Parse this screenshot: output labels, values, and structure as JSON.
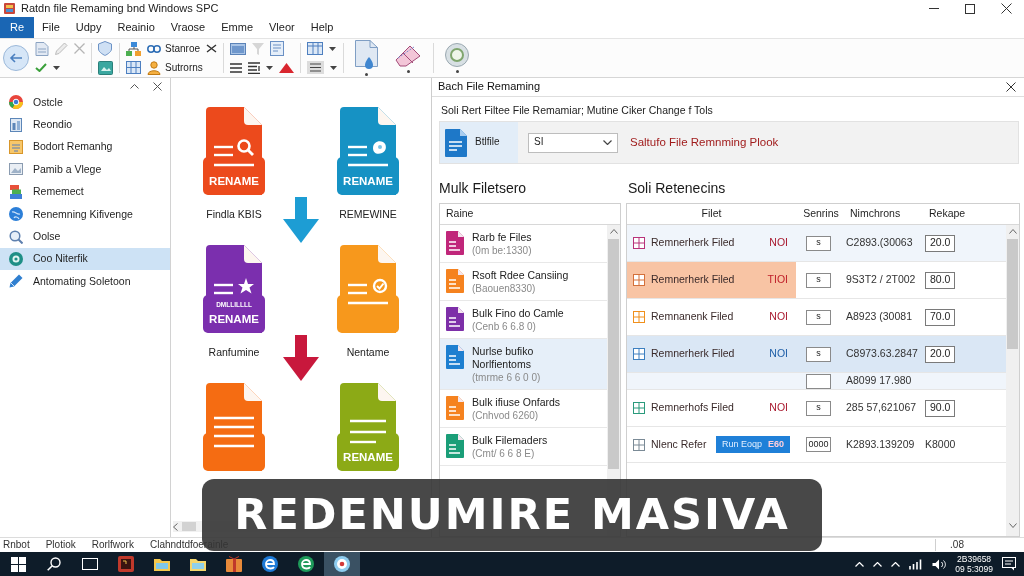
{
  "window": {
    "title": "Ratdn file Remaming bnd Windows SPC"
  },
  "menu": [
    {
      "label": "Re",
      "selected": true
    },
    {
      "label": "File",
      "selected": false
    },
    {
      "label": "Udpy",
      "selected": false
    },
    {
      "label": "Reainio",
      "selected": false
    },
    {
      "label": "Vraose",
      "selected": false
    },
    {
      "label": "Emme",
      "selected": false
    },
    {
      "label": "Vleor",
      "selected": false
    },
    {
      "label": "Help",
      "selected": false
    }
  ],
  "toolbar": {
    "labels": [
      "Stanroe",
      "Sutrorns"
    ]
  },
  "sidebar": {
    "items": [
      {
        "label": "Ostcle",
        "selected": false
      },
      {
        "label": "Reondio",
        "selected": false
      },
      {
        "label": "Bodort Remanhg",
        "selected": false
      },
      {
        "label": "Pamib a Vlege",
        "selected": false
      },
      {
        "label": "Rememect",
        "selected": false
      },
      {
        "label": "Renemning Kifivenge",
        "selected": false
      },
      {
        "label": "Oolse",
        "selected": false
      },
      {
        "label": "Coo Niterfik",
        "selected": true
      },
      {
        "label": "Antomating Soletoon",
        "selected": false
      }
    ]
  },
  "preview": {
    "tiles": [
      {
        "kind": "search",
        "color": "#ec4a1c",
        "text": "RENAME",
        "caption": "Findla KBIS"
      },
      {
        "kind": "badge",
        "color": "#1692c4",
        "text": "RENAME",
        "caption": "REMEWINE"
      },
      {
        "kind": "star",
        "color": "#7b2fae",
        "text": "RENAME",
        "subtext": "DMLLILLLL",
        "caption": "Ranfumine"
      },
      {
        "kind": "check",
        "color": "#f7981c",
        "caption": "Nentame"
      },
      {
        "kind": "lines",
        "color": "#f56c12"
      },
      {
        "kind": "lines",
        "color": "#8caa16",
        "text": "RENAME"
      }
    ],
    "arrows": [
      {
        "color": "#1d9dd4"
      },
      {
        "color": "#c8183c"
      }
    ]
  },
  "tool_panel": {
    "title": "Bach File Remaming",
    "subtitle": "Soli Rert Filtee File Remamiar; Mutine Ciker Change f Tols",
    "source_label": "Btlfile",
    "select_value": "SI",
    "notice": "Saltufo File Remnming Plook"
  },
  "file_list": {
    "heading": "Mulk Filetsero",
    "column": "Raine",
    "items": [
      {
        "title": "Rarb fe Files",
        "detail": "(0m be:1330)",
        "color": "#c0267a",
        "selected": false
      },
      {
        "title": "Rsoft Rdee Cansiing",
        "detail": "(Baouen8330)",
        "color": "#f5821f",
        "selected": false
      },
      {
        "title": "Bulk Fino do Camle",
        "detail": "(Cenb 6 6.8 0)",
        "color": "#7d2fa8",
        "selected": false
      },
      {
        "title": "Nurlse bufiko\nNorlfientoms",
        "detail": "(tmrme 6 6 0 0)",
        "color": "#1e7fd0",
        "selected": true
      },
      {
        "title": "Bulk ifiuse Onfards",
        "detail": "(Cnhvod 6260)",
        "color": "#f5821f",
        "selected": false
      },
      {
        "title": "Bulk Filemaders",
        "detail": "(Cmt/ 6 6 8 E)",
        "color": "#1a9e78",
        "selected": false
      }
    ]
  },
  "results": {
    "heading": "Soli Retenecins",
    "columns": [
      "Filet",
      "Senrins",
      "Nimchrons",
      "Rekape"
    ],
    "rows": [
      {
        "kind": "file",
        "name": "Remnerherk Filed",
        "flag": {
          "text": "NOI",
          "color": "#a8192e"
        },
        "color": "#b8327a",
        "sequence": "s",
        "range": "C2893.(30063",
        "result": "20.0",
        "highlighted": true,
        "flagged": false,
        "selected": false
      },
      {
        "kind": "file",
        "name": "Remnerherk Filed",
        "flag": {
          "text": "TIOI",
          "color": "#c0202a"
        },
        "color": "#d4703a",
        "sequence": "s",
        "range": "9S3T2 / 2T002",
        "result": "80.0",
        "highlighted": false,
        "flagged": true,
        "selected": false
      },
      {
        "kind": "file",
        "name": "Remnanenk Filed",
        "flag": {
          "text": "NOI",
          "color": "#a8192e"
        },
        "color": "#f0901c",
        "sequence": "s",
        "range": "A8923 (30081",
        "result": "70.0",
        "highlighted": false,
        "flagged": false,
        "selected": false
      },
      {
        "kind": "file",
        "name": "Remnerherk Filed",
        "flag": {
          "text": "NOI",
          "color": "#1f5fa8"
        },
        "color": "#3c7fc0",
        "sequence": "s",
        "range": "C8973.63.2847",
        "result": "20.0",
        "highlighted": false,
        "flagged": false,
        "selected": true
      },
      {
        "kind": "continuation",
        "range": "A8099 17.980",
        "highlighted": true,
        "flagged": false,
        "selected": false
      },
      {
        "kind": "file",
        "name": "Remnerhofs Filed",
        "flag": {
          "text": "NOI",
          "color": "#a8192e"
        },
        "color": "#2a9a7c",
        "sequence": "s",
        "range": "285 57,621067",
        "result": "90.0",
        "highlighted": false,
        "flagged": false,
        "selected": false
      },
      {
        "kind": "action",
        "name": "Nlenc Refer",
        "button": "Run Eoqp",
        "button_badge": "E60",
        "color": "#7a8a96",
        "sequence": "0000",
        "range": "K2893.139209",
        "result": "K8000",
        "highlighted": false,
        "flagged": false,
        "selected": false
      }
    ]
  },
  "status_bar": {
    "items": [
      "Rnbot",
      "Plotiok",
      "Rorlfwork",
      "Clahndtdfoerainle"
    ],
    "right": ".08"
  },
  "taskbar": {
    "apps": [
      {
        "active": false
      },
      {
        "active": false
      },
      {
        "active": false
      },
      {
        "active": false
      },
      {
        "active": false
      },
      {
        "active": false
      },
      {
        "active": true
      }
    ],
    "clock": [
      "2B39658",
      "09 5:3099"
    ]
  },
  "caption_banner": {
    "text": "REDENUMIRE MASIVA"
  }
}
